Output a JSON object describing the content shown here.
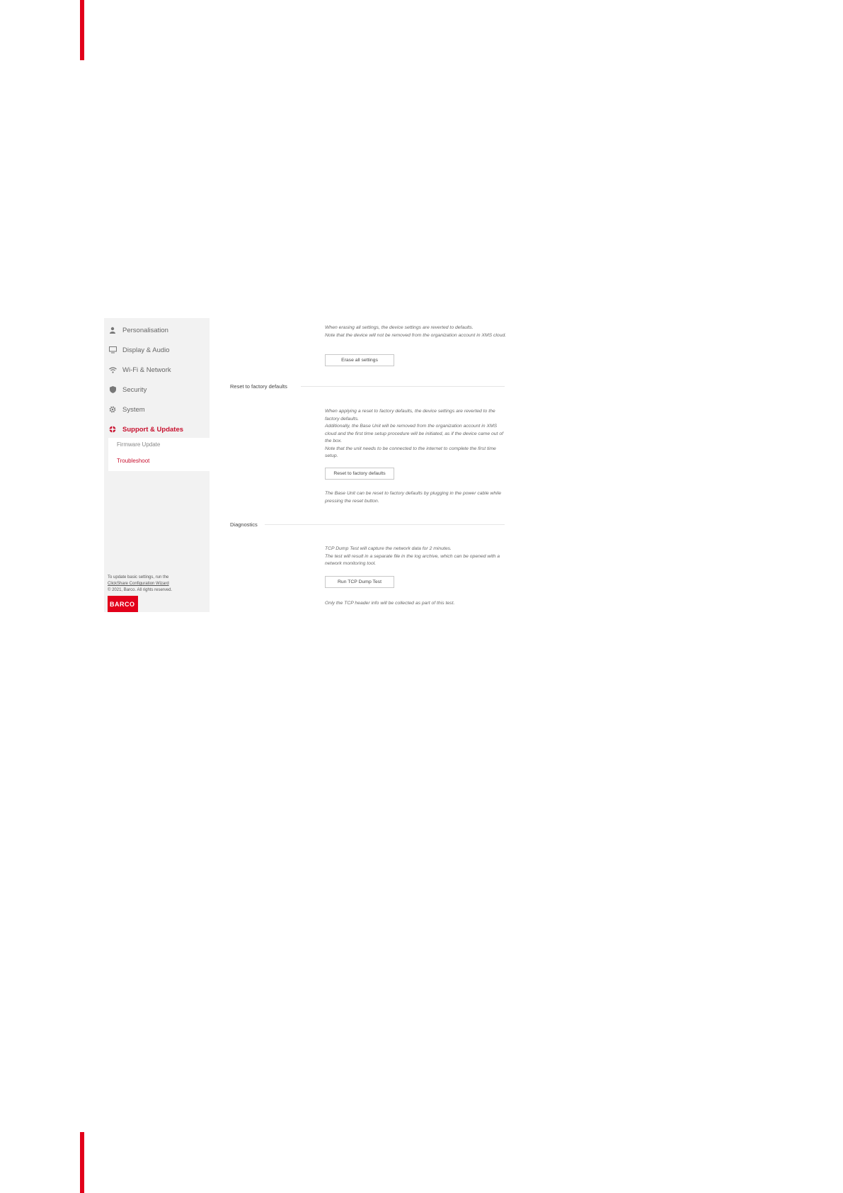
{
  "sidebar": {
    "items": [
      {
        "label": "Personalisation",
        "icon": "user-icon",
        "active": false
      },
      {
        "label": "Display & Audio",
        "icon": "monitor-icon",
        "active": false
      },
      {
        "label": "Wi-Fi & Network",
        "icon": "wifi-icon",
        "active": false
      },
      {
        "label": "Security",
        "icon": "shield-icon",
        "active": false
      },
      {
        "label": "System",
        "icon": "gear-icon",
        "active": false
      },
      {
        "label": "Support & Updates",
        "icon": "lifebuoy-icon",
        "active": true
      }
    ],
    "submenu": [
      {
        "label": "Firmware Update",
        "active": false
      },
      {
        "label": "Troubleshoot",
        "active": true
      }
    ],
    "footer": {
      "text": "To update basic settings, run the",
      "link": "ClickShare Configuration Wizard",
      "copyright": "© 2021, Barco. All rights reserved.",
      "logo": "BARCO"
    }
  },
  "erase": {
    "text_line1": "When erasing all settings, the device settings are reverted to defaults.",
    "text_line2": "Note that the device will not be removed from the organization account in XMS cloud.",
    "button": "Erase all settings"
  },
  "reset": {
    "title": "Reset to factory defaults",
    "text_line1": "When applying a reset to factory defaults, the device settings are reverted to the factory defaults.",
    "text_line2": "Additionally, the Base Unit will be removed from the organization account in XMS cloud and the first time setup procedure will be initiated, as if the device came out of the box.",
    "text_line3": "Note that the unit needs to be connected to the internet to complete the first time setup.",
    "button": "Reset to factory defaults",
    "note": "The Base Unit can be reset to factory defaults by plugging in the power cable while pressing the reset button."
  },
  "diagnostics": {
    "title": "Diagnostics",
    "text_line1": "TCP Dump Test will capture the network data for 2 minutes.",
    "text_line2": "The test will result in a separate file in the log archive, which can be opened with a network monitoring tool.",
    "button": "Run TCP Dump Test",
    "note": "Only the TCP header info will be collected as part of this test."
  },
  "colors": {
    "accent": "#e2001a",
    "active_text": "#c8102e",
    "sidebar_bg": "#f2f2f2"
  }
}
